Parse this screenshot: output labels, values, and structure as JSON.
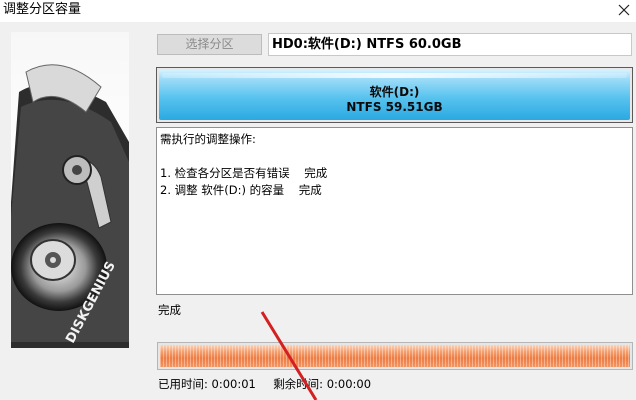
{
  "window": {
    "title": "调整分区容量"
  },
  "icons": {
    "close": "close-icon",
    "logo": "diskgenius-logo"
  },
  "side_image": {
    "logo_text": "DISKGENIUS"
  },
  "toolbar": {
    "select_partition_label": "选择分区",
    "disk_info": "HD0:软件(D:) NTFS 60.0GB"
  },
  "partition": {
    "name": "软件(D:)",
    "size": "NTFS 59.51GB",
    "color": "#3db4e8"
  },
  "operations": {
    "header": "需执行的调整操作:",
    "items": [
      "1. 检查各分区是否有错误    完成",
      "2. 调整 软件(D:) 的容量    完成"
    ]
  },
  "status": {
    "text": "完成"
  },
  "progress": {
    "fraction": 1.0,
    "color": "#ee7c42"
  },
  "time": {
    "elapsed_label": "已用时间:",
    "elapsed_value": "0:00:01",
    "remaining_label": "剩余时间:",
    "remaining_value": "0:00:00"
  }
}
